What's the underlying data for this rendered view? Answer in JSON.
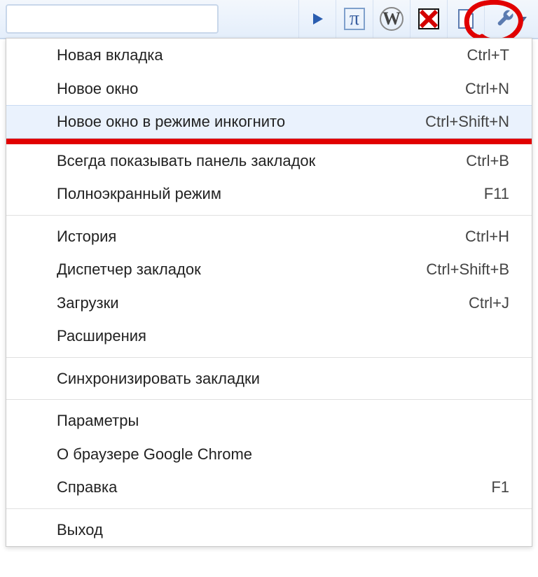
{
  "toolbar": {
    "icons": {
      "play": "play-icon",
      "pi": "pi-icon",
      "wiki": "wikipedia-icon",
      "blocked": "blocked-x-icon",
      "page": "page-icon",
      "wrench": "wrench-icon",
      "caret": "dropdown-caret-icon"
    },
    "pi_glyph": "π",
    "wiki_glyph": "W"
  },
  "menu": {
    "groups": [
      [
        {
          "label": "Новая вкладка",
          "shortcut": "Ctrl+T"
        },
        {
          "label": "Новое окно",
          "shortcut": "Ctrl+N"
        },
        {
          "label": "Новое окно в режиме инкогнито",
          "shortcut": "Ctrl+Shift+N",
          "hover": true,
          "underline_after": true
        }
      ],
      [
        {
          "label": "Всегда показывать панель закладок",
          "shortcut": "Ctrl+B"
        },
        {
          "label": "Полноэкранный режим",
          "shortcut": "F11"
        }
      ],
      [
        {
          "label": "История",
          "shortcut": "Ctrl+H"
        },
        {
          "label": "Диспетчер закладок",
          "shortcut": "Ctrl+Shift+B"
        },
        {
          "label": "Загрузки",
          "shortcut": "Ctrl+J"
        },
        {
          "label": "Расширения",
          "shortcut": ""
        }
      ],
      [
        {
          "label": "Синхронизировать закладки",
          "shortcut": ""
        }
      ],
      [
        {
          "label": "Параметры",
          "shortcut": ""
        },
        {
          "label": "О браузере Google Chrome",
          "shortcut": ""
        },
        {
          "label": "Справка",
          "shortcut": "F1"
        }
      ],
      [
        {
          "label": "Выход",
          "shortcut": ""
        }
      ]
    ]
  },
  "annotation": {
    "circle_color": "#e10000"
  }
}
